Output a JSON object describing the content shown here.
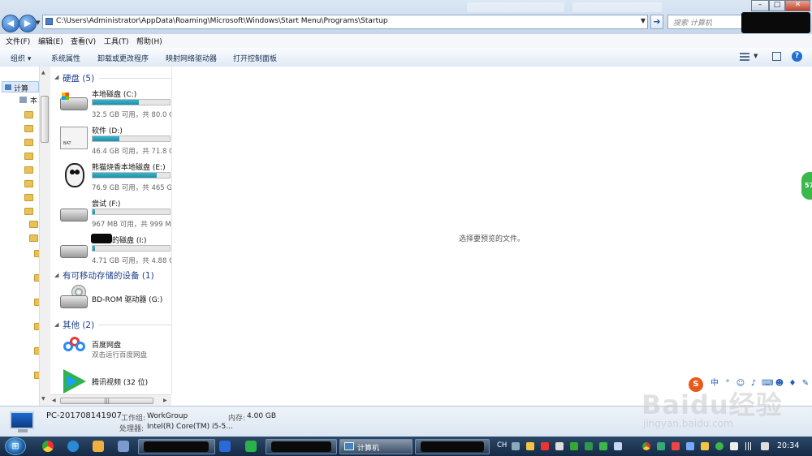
{
  "window": {
    "address_path": "C:\\Users\\Administrator\\AppData\\Roaming\\Microsoft\\Windows\\Start Menu\\Programs\\Startup",
    "search_placeholder": "搜索 计算机"
  },
  "menu": [
    "文件(F)",
    "编辑(E)",
    "查看(V)",
    "工具(T)",
    "帮助(H)"
  ],
  "toolbar": {
    "organize": "组织 ▾",
    "items": [
      "系统属性",
      "卸载或更改程序",
      "映射网络驱动器",
      "打开控制面板"
    ]
  },
  "nav": {
    "computer": "计算",
    "local": "本"
  },
  "groups": {
    "hdd": "硬盘 (5)",
    "removable": "有可移动存储的设备 (1)",
    "other": "其他 (2)"
  },
  "drives": [
    {
      "name": "本地磁盘 (C:)",
      "free": "32.5 GB 可用，共 80.0 G",
      "used_pct": 60
    },
    {
      "name": "软件 (D:)",
      "free": "46.4 GB 可用，共 71.8 G",
      "used_pct": 35
    },
    {
      "name": "熊猫烧香本地磁盘 (E:)",
      "free": "76.9 GB 可用，共 465 G",
      "used_pct": 83
    },
    {
      "name": "尝试 (F:)",
      "free": "967 MB 可用，共 999 M",
      "used_pct": 3
    },
    {
      "name": "的磁盘 (I:)",
      "free": "4.71 GB 可用，共 4.88 G",
      "used_pct": 3
    }
  ],
  "removable": {
    "name": "BD-ROM 驱动器 (G:)"
  },
  "other": [
    {
      "name": "百度网盘",
      "sub": "双击运行百度网盘"
    },
    {
      "name": "腾讯视频 (32 位)"
    }
  ],
  "preview_message": "选择要预览的文件。",
  "side_badge": "57",
  "details": {
    "pc_name": "PC-201708141907",
    "workgroup_label": "工作组:",
    "workgroup": "WorkGroup",
    "memory_label": "内存:",
    "memory": "4.00 GB",
    "cpu_label": "处理器:",
    "cpu": "Intel(R) Core(TM) i5-5..."
  },
  "taskbar": {
    "active_task": "计算机",
    "lang": "CH",
    "time": "20:34"
  },
  "watermark": {
    "logo": "Baidu经验",
    "sub": "jingyan.baidu.com"
  },
  "colors": {
    "accent": "#1e3f8c",
    "bar_fill": "#1b8fab",
    "taskbar": "#152a45"
  }
}
